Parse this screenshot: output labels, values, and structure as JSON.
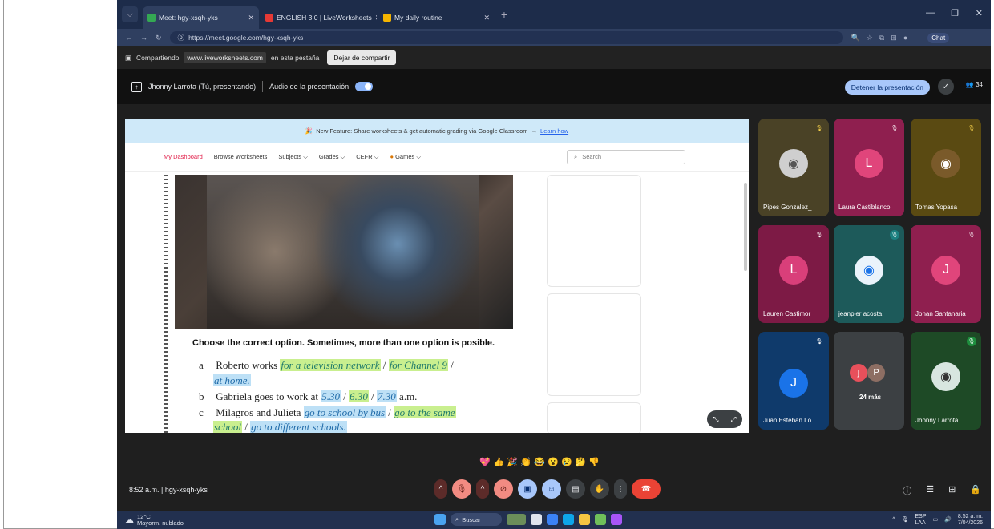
{
  "browser": {
    "tabs": [
      {
        "label": "Meet: hgy-xsqh-yks",
        "active": true
      },
      {
        "label": "ENGLISH 3.0 | LiveWorksheets",
        "active": false
      },
      {
        "label": "My daily routine",
        "active": false
      }
    ],
    "url": "https://meet.google.com/hgy-xsqh-yks",
    "chat_label": "Chat"
  },
  "sharebar": {
    "prefix": "Compartiendo",
    "domain": "www.liveworksheets.com",
    "suffix": "en esta pestaña",
    "stop_label": "Dejar de compartir"
  },
  "meet_top": {
    "presenter": "Jhonny Larrota (Tú, presentando)",
    "audio_label": "Audio de la presentación",
    "stop_presenting": "Detener la presentación",
    "people_count": "34"
  },
  "worksheet": {
    "banner_text": "New Feature: Share worksheets & get automatic grading via Google Classroom",
    "banner_link": "Learn how",
    "nav": [
      "My Dashboard",
      "Browse Worksheets",
      "Subjects ⌵",
      "Grades ⌵",
      "CEFR ⌵",
      "Games ⌵"
    ],
    "search_placeholder": "Search",
    "question": "Choose the correct option. Sometimes, more than one option is posible.",
    "items": [
      {
        "label": "a",
        "lead": "Roberto works",
        "o1": "for a television network",
        "o2": "for Channel 9",
        "o3": "at home."
      },
      {
        "label": "b",
        "lead": "Gabriela goes to work at",
        "o1": "5.30",
        "o2": "6.30",
        "o3": "7.30",
        "tail": "a.m."
      },
      {
        "label": "c",
        "lead": "Milagros and Julieta",
        "o1": "go to school by bus",
        "o2": "go to the same",
        "o2b": "school",
        "o3": "go to different schools."
      }
    ]
  },
  "participants": [
    {
      "name": "Pipes Gonzalez_",
      "color": "#4a4226",
      "avatar": "photo"
    },
    {
      "name": "Laura Castiblanco",
      "color": "#8f1f4f",
      "avatar": "L",
      "avatar_color": "#e0457b"
    },
    {
      "name": "Tomas Yopasa",
      "color": "#5a4a12",
      "avatar": "photo"
    },
    {
      "name": "Lauren Castimor",
      "color": "#7d1a45",
      "avatar": "L",
      "avatar_color": "#d93f7a"
    },
    {
      "name": "jeanpier acosta",
      "color": "#1d5a5a",
      "avatar": "photo"
    },
    {
      "name": "Johan Santanaria",
      "color": "#8f1f4f",
      "avatar": "J",
      "avatar_color": "#e0457b"
    },
    {
      "name": "Juan Esteban Lo...",
      "color": "#0f3a6b",
      "avatar": "J",
      "avatar_color": "#1a73e8"
    },
    {
      "name": "24 más",
      "color": "#3c4043",
      "avatar": "more"
    },
    {
      "name": "Jhonny Larrota",
      "color": "#1e4a26",
      "avatar": "photo"
    }
  ],
  "reactions": [
    "💖",
    "👍",
    "🎉",
    "👏",
    "😂",
    "😮",
    "😢",
    "🤔",
    "👎"
  ],
  "meeting_info": "8:52 a.m.  |  hgy-xsqh-yks",
  "taskbar": {
    "temp": "12°C",
    "weather": "Mayorm. nublado",
    "search": "Buscar",
    "lang1": "ESP",
    "lang2": "LAA",
    "time": "8:52 a. m.",
    "date": "7/04/2026"
  }
}
